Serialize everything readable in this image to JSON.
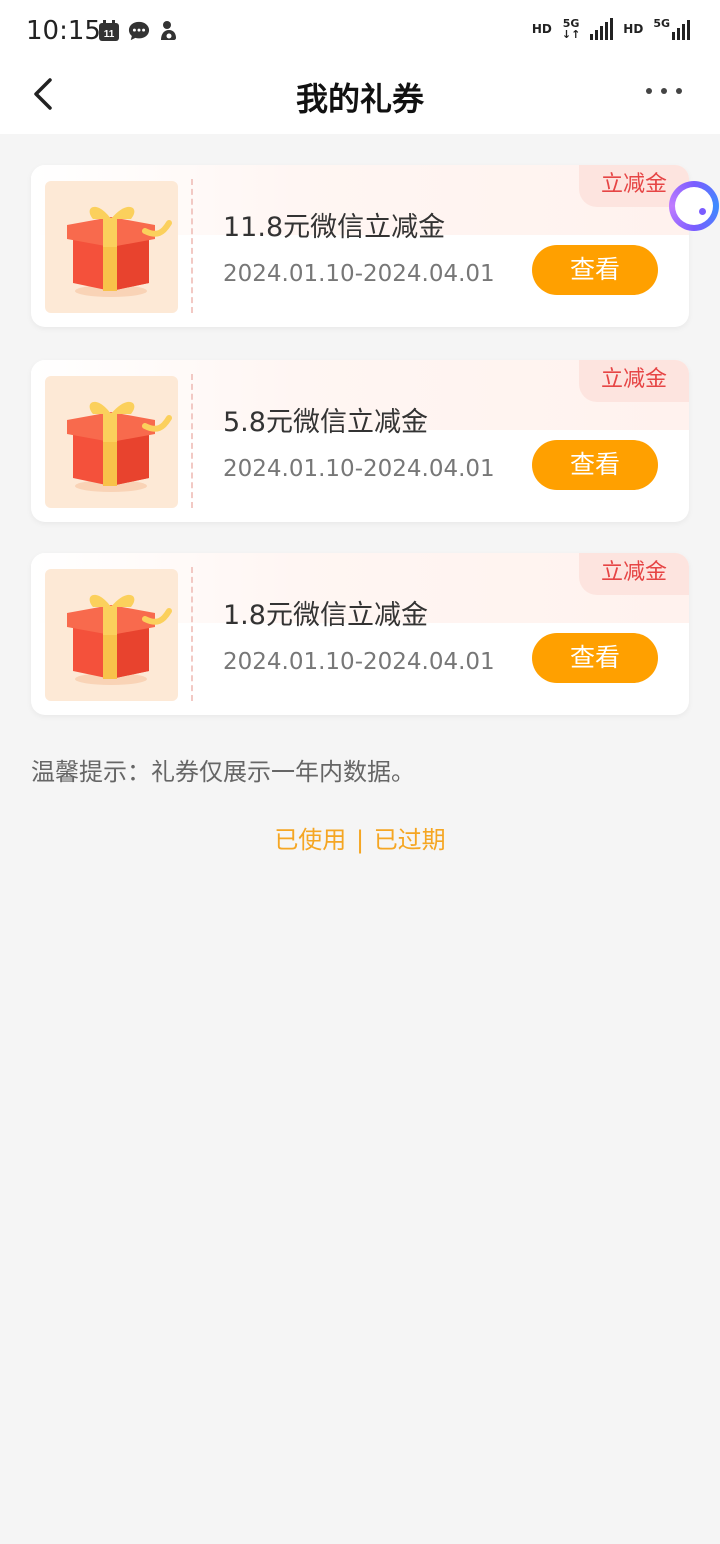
{
  "status": {
    "time": "10:15",
    "calendar_day": "11",
    "hd1": "HD",
    "net1": "5G",
    "hd2": "HD",
    "net2": "5G"
  },
  "nav": {
    "title": "我的礼券"
  },
  "coupons": [
    {
      "tag": "立减金",
      "title": "11.8元微信立减金",
      "date": "2024.01.10-2024.04.01",
      "button": "查看"
    },
    {
      "tag": "立减金",
      "title": "5.8元微信立减金",
      "date": "2024.01.10-2024.04.01",
      "button": "查看"
    },
    {
      "tag": "立减金",
      "title": "1.8元微信立减金",
      "date": "2024.01.10-2024.04.01",
      "button": "查看"
    }
  ],
  "tip": "温馨提示：礼券仅展示一年内数据。",
  "links": {
    "used": "已使用",
    "separator": "|",
    "expired": "已过期"
  },
  "colors": {
    "accent": "#ffa000",
    "tag_text": "#e64545",
    "link": "#f5a623"
  }
}
